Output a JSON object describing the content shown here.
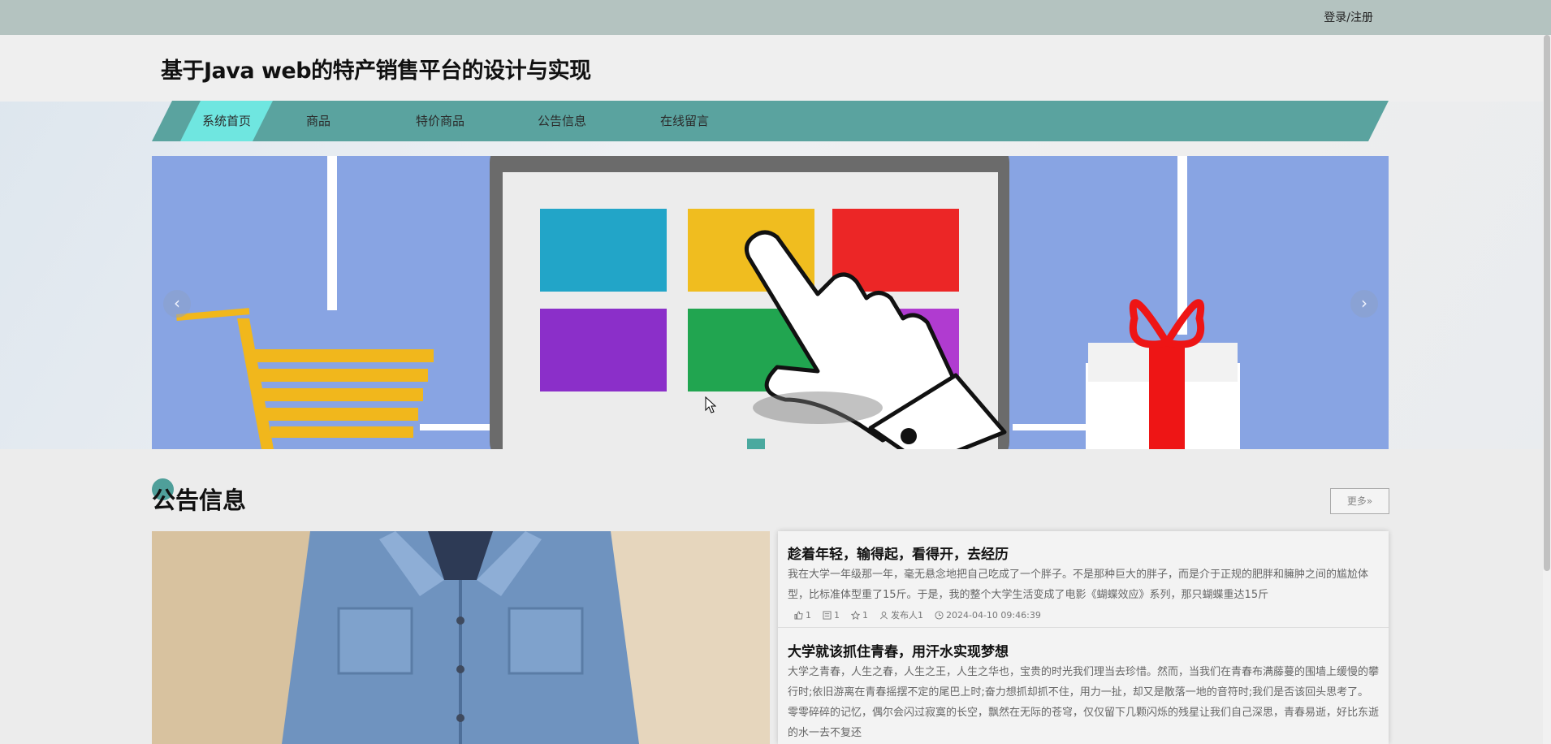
{
  "topbar": {
    "login_label": "登录/注册"
  },
  "header": {
    "site_title": "基于Java web的特产销售平台的设计与实现"
  },
  "nav": {
    "items": [
      {
        "label": "系统首页",
        "active": true
      },
      {
        "label": "商品",
        "active": false
      },
      {
        "label": "特价商品",
        "active": false
      },
      {
        "label": "公告信息",
        "active": false
      },
      {
        "label": "在线留言",
        "active": false
      }
    ]
  },
  "banner": {
    "prev_label": "‹",
    "next_label": "›"
  },
  "announcements": {
    "title": "公告信息",
    "more_label": "更多»",
    "items": [
      {
        "title": "趁着年轻，输得起，看得开，去经历",
        "summary": "我在大学一年级那一年，毫无悬念地把自己吃成了一个胖子。不是那种巨大的胖子，而是介于正规的肥胖和臃肿之间的尴尬体型，比标准体型重了15斤。于是，我的整个大学生活变成了电影《蝴蝶效应》系列，那只蝴蝶重达15斤",
        "likes": "1",
        "comments": "1",
        "favorites": "1",
        "publisher": "发布人1",
        "time": "2024-04-10 09:46:39"
      },
      {
        "title": "大学就该抓住青春，用汗水实现梦想",
        "summary": "大学之青春，人生之春，人生之王，人生之华也，宝贵的时光我们理当去珍惜。然而，当我们在青春布满藤蔓的围墙上缓慢的攀行时;依旧游离在青春摇摆不定的尾巴上时;奋力想抓却抓不住，用力一扯，却又是散落一地的音符时;我们是否该回头思考了。零零碎碎的记忆，偶尔会闪过寂寞的长空，飘然在无际的苍穹，仅仅留下几颗闪烁的残星让我们自己深思，青春易逝，好比东逝的水一去不复还"
      }
    ]
  },
  "colors": {
    "nav_bg": "#5aa39f",
    "nav_active": "#6fe6e0",
    "topbar": "#b4c3c0",
    "banner_bg": "#88a4e3"
  }
}
